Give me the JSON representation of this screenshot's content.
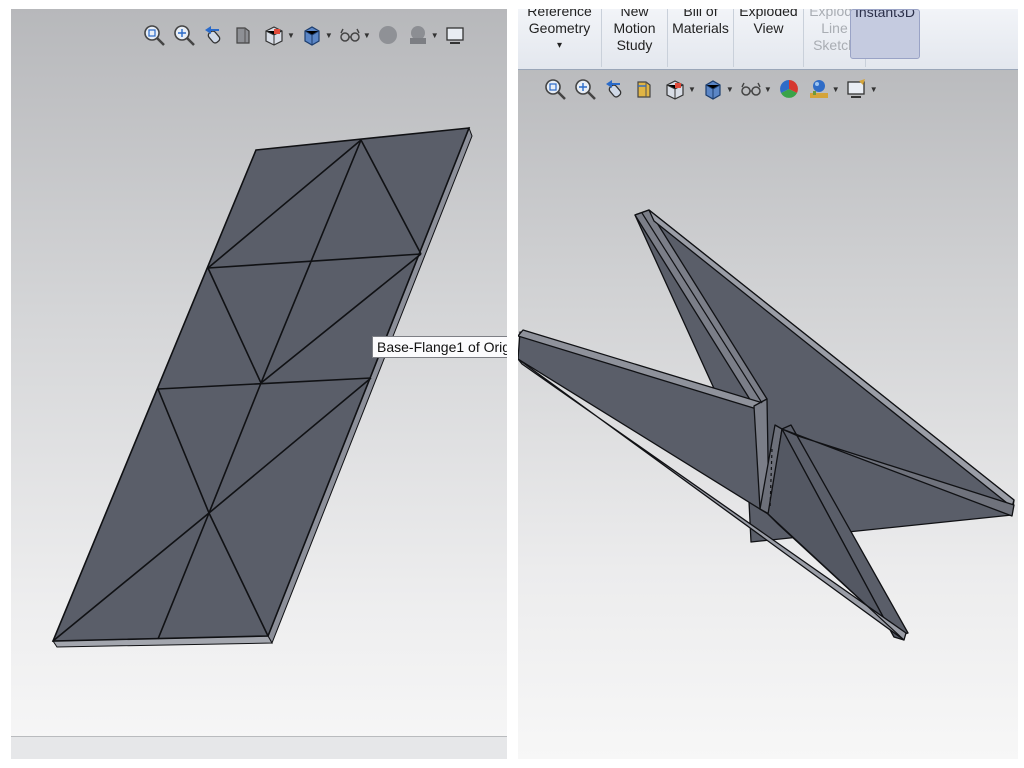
{
  "left_view": {
    "toolbar": {
      "icons": [
        "zoom-to-fit-icon",
        "zoom-to-area-icon",
        "previous-view-icon",
        "section-view-icon",
        "view-orientation-icon",
        "display-style-icon",
        "hide-show-items-icon",
        "edit-appearance-icon",
        "apply-scene-icon",
        "view-settings-icon"
      ]
    },
    "tooltip": "Base-Flange1 of Orig"
  },
  "right_view": {
    "ribbon": {
      "commands": [
        {
          "lines": [
            "Reference",
            "Geometry",
            "▾"
          ],
          "state": "normal"
        },
        {
          "lines": [
            "New",
            "Motion",
            "Study"
          ],
          "state": "normal"
        },
        {
          "lines": [
            "Bill of",
            "Materials"
          ],
          "state": "normal"
        },
        {
          "lines": [
            "Exploded",
            "View"
          ],
          "state": "normal"
        },
        {
          "lines": [
            "Explode",
            "Line",
            "Sketch"
          ],
          "state": "disabled"
        },
        {
          "lines": [
            "Instant3D"
          ],
          "state": "active"
        }
      ]
    },
    "toolbar": {
      "icons": [
        "zoom-to-fit-icon",
        "zoom-to-area-icon",
        "previous-view-icon",
        "section-view-icon",
        "view-orientation-icon",
        "display-style-icon",
        "hide-show-items-icon",
        "edit-appearance-icon",
        "apply-scene-icon",
        "view-settings-icon"
      ]
    }
  },
  "colors": {
    "sheet_fill": "#5a5e69",
    "sheet_edge": "#101114",
    "sheet_side": "#8c8f99",
    "accent_active": "#c5cbe0"
  }
}
